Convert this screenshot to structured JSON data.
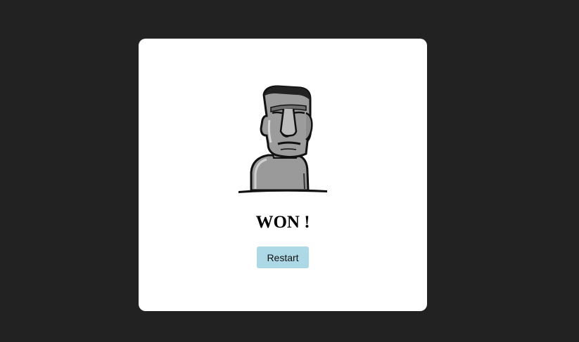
{
  "game": {
    "result_text": "WON !",
    "restart_label": "Restart"
  },
  "colors": {
    "page_background": "#222222",
    "card_background": "#ffffff",
    "button_background": "#add8e6"
  },
  "icons": {
    "result_image": "moai-statue-icon"
  }
}
